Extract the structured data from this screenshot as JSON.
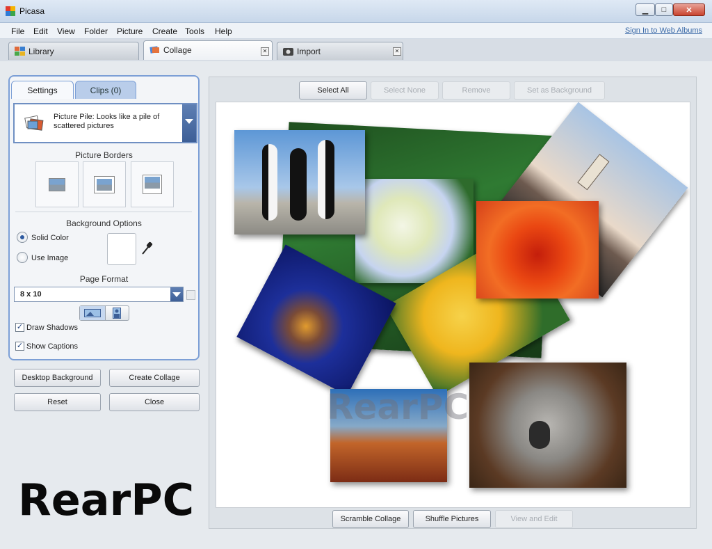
{
  "window": {
    "title": "Picasa"
  },
  "menu": [
    "File",
    "Edit",
    "View",
    "Folder",
    "Picture",
    "Create",
    "Tools",
    "Help"
  ],
  "signin_link": "Sign In to Web Albums",
  "tabs": [
    {
      "label": "Library",
      "icon": "library-icon"
    },
    {
      "label": "Collage",
      "icon": "collage-icon"
    },
    {
      "label": "Import",
      "icon": "import-icon"
    }
  ],
  "panel": {
    "tabs": {
      "settings": "Settings",
      "clips": "Clips (0)"
    },
    "style": {
      "text": "Picture Pile:  Looks like a pile of scattered pictures"
    },
    "picture_borders_title": "Picture Borders",
    "background_options_title": "Background Options",
    "solid_color": "Solid Color",
    "use_image": "Use Image",
    "page_format_title": "Page Format",
    "page_format_value": "8 x 10",
    "draw_shadows": "Draw Shadows",
    "show_captions": "Show Captions"
  },
  "buttons": {
    "desktop_background": "Desktop Background",
    "create_collage": "Create Collage",
    "reset": "Reset",
    "close": "Close"
  },
  "toolbar_top": [
    "Select All",
    "Select None",
    "Remove",
    "Set as Background"
  ],
  "toolbar_bottom": [
    "Scramble Collage",
    "Shuffle Pictures",
    "View and Edit"
  ],
  "watermark": "RearPC",
  "colors": {
    "accent": "#7c9fd6",
    "window_bg": "#e6eaee"
  }
}
